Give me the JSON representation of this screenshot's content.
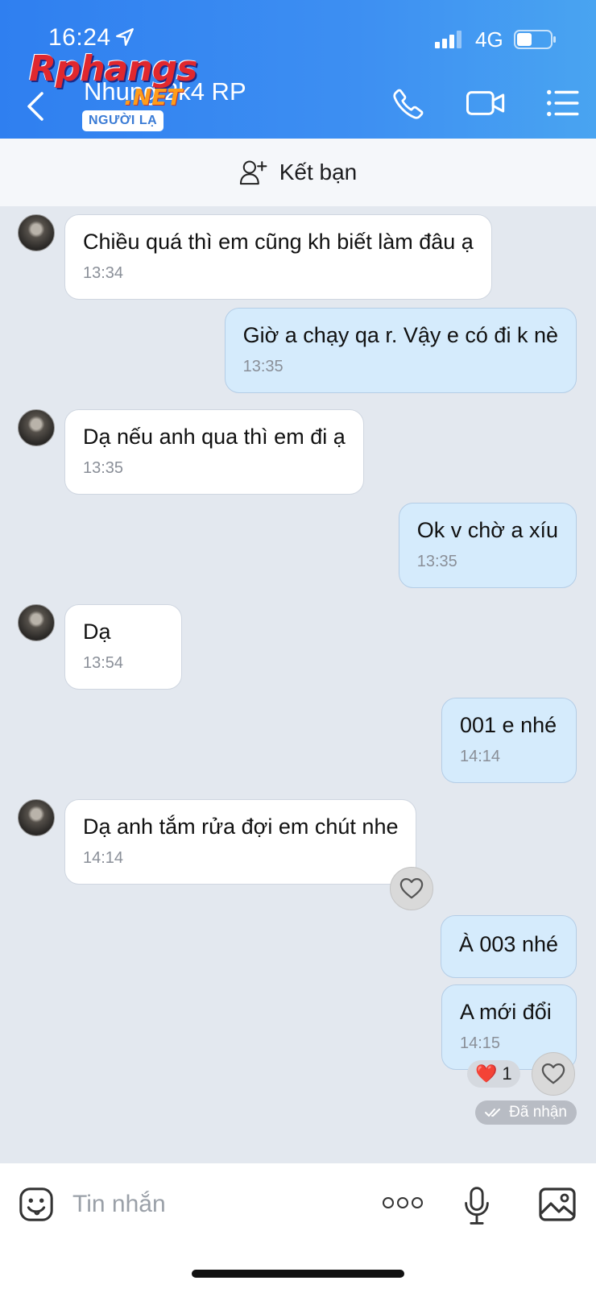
{
  "status": {
    "time": "16:24",
    "network": "4G"
  },
  "header": {
    "contact_name": "Nhung 2k4 RP",
    "badge": "NGƯỜI LẠ",
    "watermark": "Rphangs",
    "watermark_suffix": ".NET"
  },
  "friend_bar": {
    "label": "Kết bạn"
  },
  "messages": [
    {
      "dir": "in",
      "text": "Chiều quá thì em cũng kh biết làm đâu ạ",
      "time": "13:34"
    },
    {
      "dir": "out",
      "text": "Giờ a chạy qa r. Vậy e có đi k nè",
      "time": "13:35"
    },
    {
      "dir": "in",
      "text": "Dạ nếu anh qua thì em đi ạ",
      "time": "13:35"
    },
    {
      "dir": "out",
      "text": "Ok v chờ a xíu",
      "time": "13:35"
    },
    {
      "dir": "in",
      "text": "Dạ",
      "time": "13:54"
    },
    {
      "dir": "out",
      "text": "001 e nhé",
      "time": "14:14"
    },
    {
      "dir": "in",
      "text": "Dạ anh tắm rửa đợi em chút nhe",
      "time": "14:14"
    },
    {
      "dir": "out",
      "text": "À 003 nhé",
      "time": ""
    },
    {
      "dir": "out",
      "text": "A mới đổi",
      "time": "14:15"
    }
  ],
  "reaction": {
    "emoji": "❤️",
    "count": "1"
  },
  "received_label": "Đã nhận",
  "input": {
    "placeholder": "Tin nhắn"
  }
}
